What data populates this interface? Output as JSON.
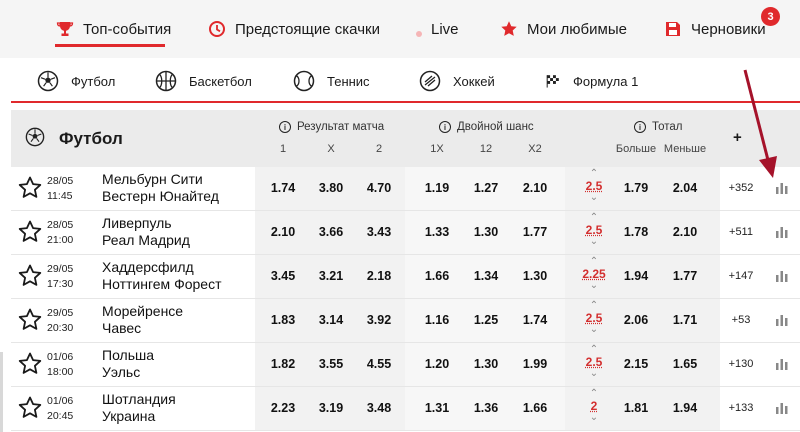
{
  "topnav": {
    "items": [
      {
        "label": "Топ-события",
        "icon": "trophy-icon"
      },
      {
        "label": "Предстоящие скачки",
        "icon": "clock-icon"
      },
      {
        "label": "Live",
        "icon": "live-dot-icon"
      },
      {
        "label": "Мои любимые",
        "icon": "star-icon"
      },
      {
        "label": "Черновики",
        "icon": "save-icon"
      }
    ],
    "drafts_badge": "3",
    "accent": "#e0292c"
  },
  "sport_tabs": [
    {
      "label": "Футбол",
      "icon": "soccer-ball-icon"
    },
    {
      "label": "Баскетбол",
      "icon": "basketball-icon"
    },
    {
      "label": "Теннис",
      "icon": "tennis-ball-icon"
    },
    {
      "label": "Хоккей",
      "icon": "hockey-puck-icon"
    },
    {
      "label": "Формула 1",
      "icon": "racing-flag-icon"
    }
  ],
  "table": {
    "title": "Футбол",
    "groups": {
      "result": {
        "label": "Результат матча",
        "cols": [
          "1",
          "X",
          "2"
        ]
      },
      "double": {
        "label": "Двойной шанс",
        "cols": [
          "1X",
          "12",
          "X2"
        ]
      },
      "total": {
        "label": "Тотал",
        "cols": [
          "Больше",
          "Меньше"
        ]
      }
    },
    "plus_label": "+",
    "rows": [
      {
        "date": "28/05",
        "time": "11:45",
        "home": "Мельбурн Сити",
        "away": "Вестерн Юнайтед",
        "o1": "1.74",
        "ox": "3.80",
        "o2": "4.70",
        "d1x": "1.19",
        "d12": "1.27",
        "dx2": "2.10",
        "tline": "2.5",
        "tover": "1.79",
        "tunder": "2.04",
        "more": "+352"
      },
      {
        "date": "28/05",
        "time": "21:00",
        "home": "Ливерпуль",
        "away": "Реал Мадрид",
        "o1": "2.10",
        "ox": "3.66",
        "o2": "3.43",
        "d1x": "1.33",
        "d12": "1.30",
        "dx2": "1.77",
        "tline": "2.5",
        "tover": "1.78",
        "tunder": "2.10",
        "more": "+511"
      },
      {
        "date": "29/05",
        "time": "17:30",
        "home": "Хаддерсфилд",
        "away": "Ноттингем Форест",
        "o1": "3.45",
        "ox": "3.21",
        "o2": "2.18",
        "d1x": "1.66",
        "d12": "1.34",
        "dx2": "1.30",
        "tline": "2.25",
        "tover": "1.94",
        "tunder": "1.77",
        "more": "+147"
      },
      {
        "date": "29/05",
        "time": "20:30",
        "home": "Морейренсе",
        "away": "Чавес",
        "o1": "1.83",
        "ox": "3.14",
        "o2": "3.92",
        "d1x": "1.16",
        "d12": "1.25",
        "dx2": "1.74",
        "tline": "2.5",
        "tover": "2.06",
        "tunder": "1.71",
        "more": "+53"
      },
      {
        "date": "01/06",
        "time": "18:00",
        "home": "Польша",
        "away": "Уэльс",
        "o1": "1.82",
        "ox": "3.55",
        "o2": "4.55",
        "d1x": "1.20",
        "d12": "1.30",
        "dx2": "1.99",
        "tline": "2.5",
        "tover": "2.15",
        "tunder": "1.65",
        "more": "+130"
      },
      {
        "date": "01/06",
        "time": "20:45",
        "home": "Шотландия",
        "away": "Украина",
        "o1": "2.23",
        "ox": "3.19",
        "o2": "3.48",
        "d1x": "1.31",
        "d12": "1.36",
        "dx2": "1.66",
        "tline": "2",
        "tover": "1.81",
        "tunder": "1.94",
        "more": "+133"
      }
    ]
  }
}
